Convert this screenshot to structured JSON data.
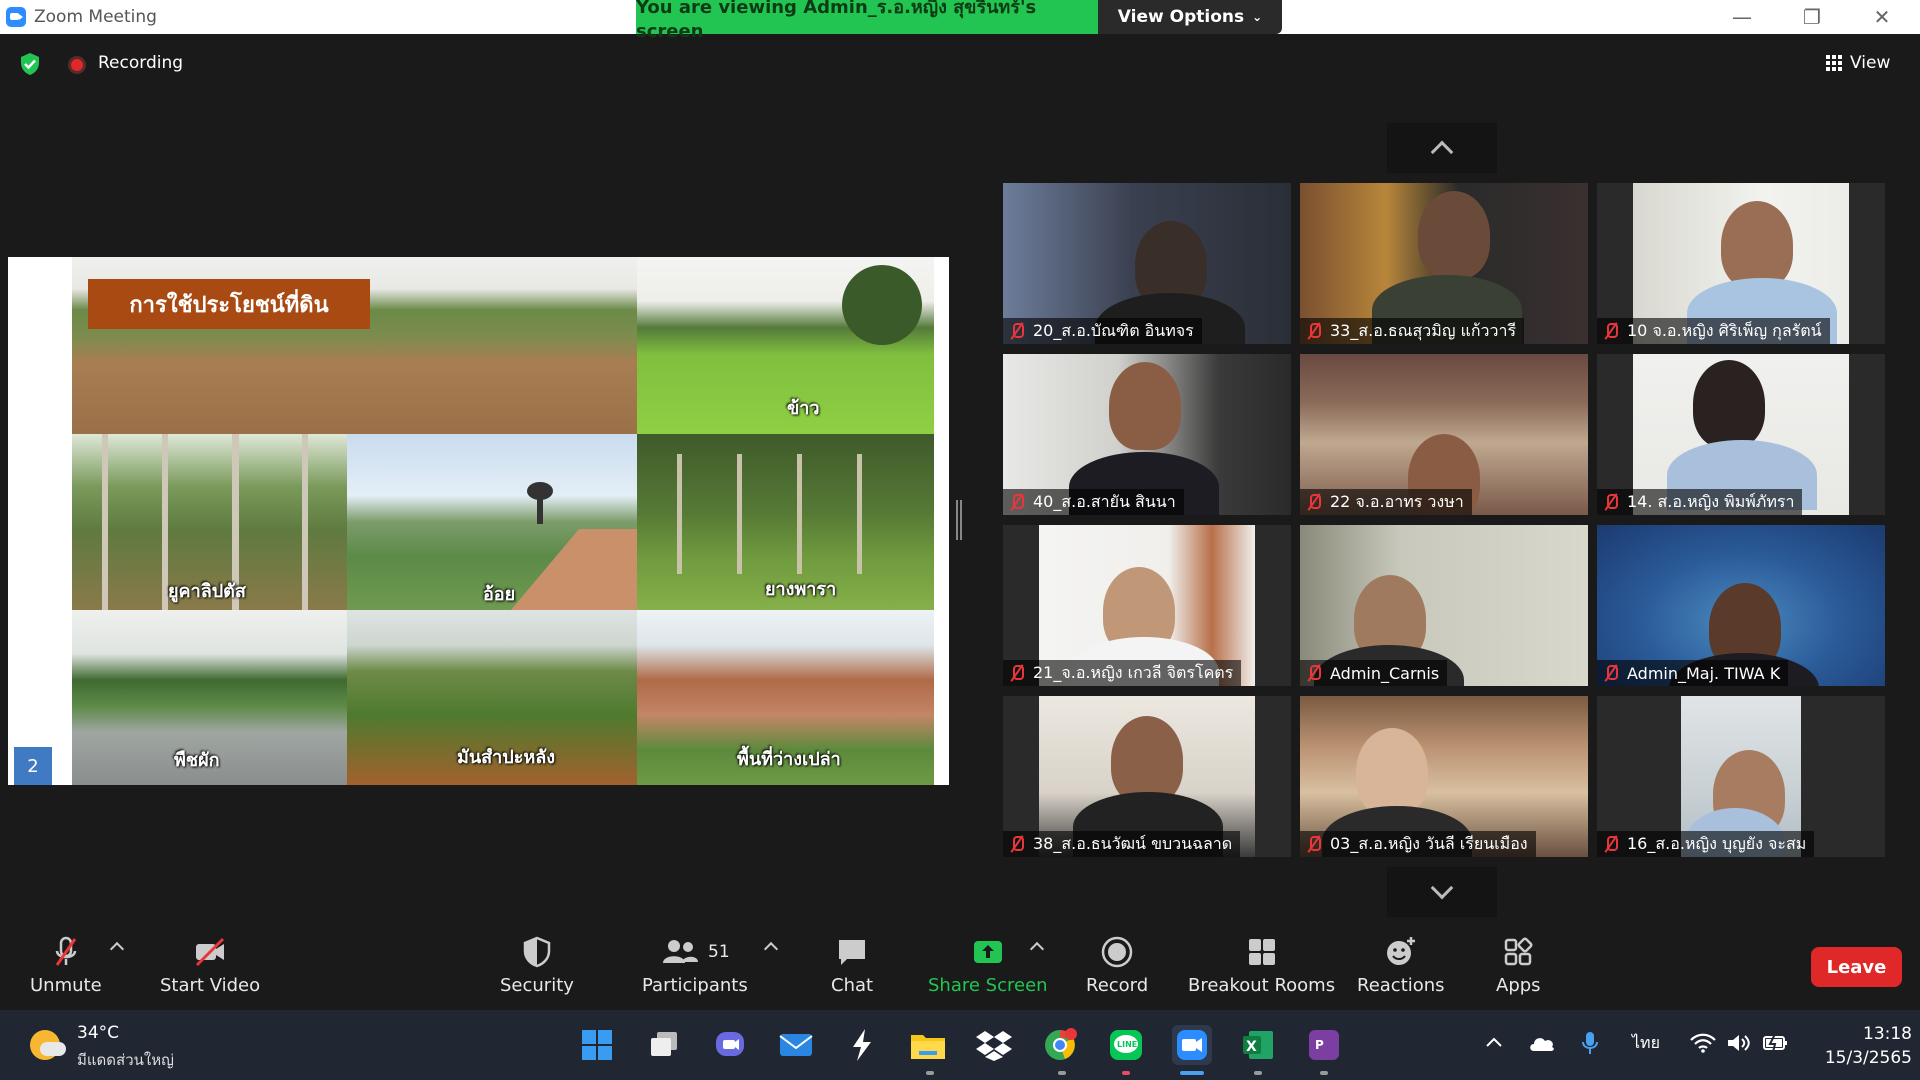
{
  "window": {
    "title": "Zoom Meeting",
    "banner": "You are viewing Admin_ร.อ.หญิง สุขรินทร์'s screen",
    "view_options": "View Options",
    "minimize": "—",
    "maximize": "❐",
    "close": "✕"
  },
  "status": {
    "recording": "Recording",
    "view": "View"
  },
  "slide": {
    "title": "การใช้ประโยชน์ที่ดิน",
    "page_number": "2",
    "photos": [
      {
        "label": "ข้าว"
      },
      {
        "label": "ยูคาลิปตัส"
      },
      {
        "label": "อ้อย"
      },
      {
        "label": "ยางพารา"
      },
      {
        "label": "พืชผัก"
      },
      {
        "label": "มันสำปะหลัง"
      },
      {
        "label": "พื้นที่ว่างเปล่า"
      }
    ]
  },
  "participants_gallery": [
    {
      "name": "20_ส.อ.บัณฑิต อินทจร"
    },
    {
      "name": "33_ส.อ.ธณสุวมิญ  แก้ววารี"
    },
    {
      "name": "10 จ.อ.หญิง ศิริเพ็ญ กุลรัตน์"
    },
    {
      "name": "40_ส.อ.สายัน สินนา"
    },
    {
      "name": "22 จ.อ.อาทร  วงษา"
    },
    {
      "name": "14. ส.อ.หญิง พิมพ์ภัทรา"
    },
    {
      "name": "21_จ.อ.หญิง เกวลี จิตรโคตร"
    },
    {
      "name": "Admin_Carnis"
    },
    {
      "name": "Admin_Maj. TIWA K"
    },
    {
      "name": "38_ส.อ.ธนวัฒน์ ขบวนฉลาด"
    },
    {
      "name": "03_ส.อ.หญิง วันลี เรียนเมือง"
    },
    {
      "name": "16_ส.อ.หญิง บุญยัง  จะสม"
    }
  ],
  "toolbar": {
    "unmute": "Unmute",
    "start_video": "Start Video",
    "security": "Security",
    "participants": "Participants",
    "participants_count": "51",
    "chat": "Chat",
    "share_screen": "Share Screen",
    "record": "Record",
    "breakout_rooms": "Breakout Rooms",
    "reactions": "Reactions",
    "apps": "Apps",
    "leave": "Leave"
  },
  "taskbar": {
    "temperature": "34°C",
    "weather_desc": "มีแดดส่วนใหญ่",
    "language": "ไทย",
    "time": "13:18",
    "date": "15/3/2565"
  },
  "colors": {
    "banner_green": "#23c552",
    "leave_red": "#e02828",
    "share_green": "#23c552",
    "zoom_blue": "#2d8cff"
  }
}
